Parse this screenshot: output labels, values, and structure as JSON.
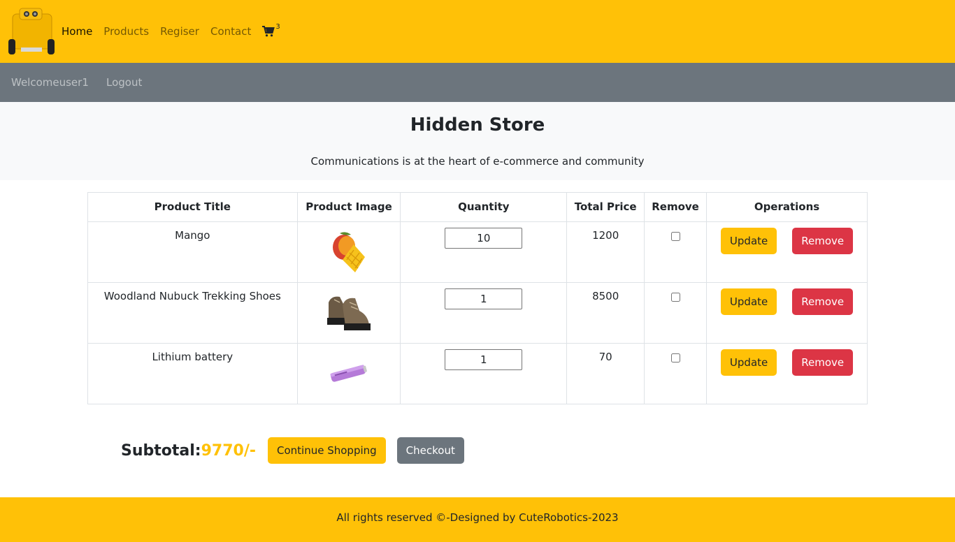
{
  "nav": {
    "logo": "robot-logo",
    "links": [
      "Home",
      "Products",
      "Regiser",
      "Contact"
    ],
    "cart_count": "3"
  },
  "userbar": {
    "welcome": "Welcomeuser1",
    "logout": "Logout"
  },
  "hero": {
    "title": "Hidden Store",
    "subtitle": "Communications is at the heart of e-commerce and community"
  },
  "table": {
    "headers": [
      "Product Title",
      "Product Image",
      "Quantity",
      "Total Price",
      "Remove",
      "Operations"
    ],
    "rows": [
      {
        "title": "Mango",
        "image": "mango-image",
        "quantity": "10",
        "total": "1200",
        "remove_checked": false
      },
      {
        "title": "Woodland Nubuck Trekking Shoes",
        "image": "shoes-image",
        "quantity": "1",
        "total": "8500",
        "remove_checked": false
      },
      {
        "title": "Lithium battery",
        "image": "battery-image",
        "quantity": "1",
        "total": "70",
        "remove_checked": false
      }
    ],
    "update_label": "Update",
    "remove_label": "Remove"
  },
  "summary": {
    "subtotal_label": "Subtotal:",
    "subtotal_value": "9770/-",
    "continue_label": "Continue Shopping",
    "checkout_label": "Checkout"
  },
  "footer": {
    "text": "All rights reserved ©-Designed by CuteRobotics-2023"
  },
  "colors": {
    "brand": "#ffc107",
    "userbar": "#6c757d",
    "danger": "#dc3545",
    "hero_bg": "#f8f9fa"
  }
}
